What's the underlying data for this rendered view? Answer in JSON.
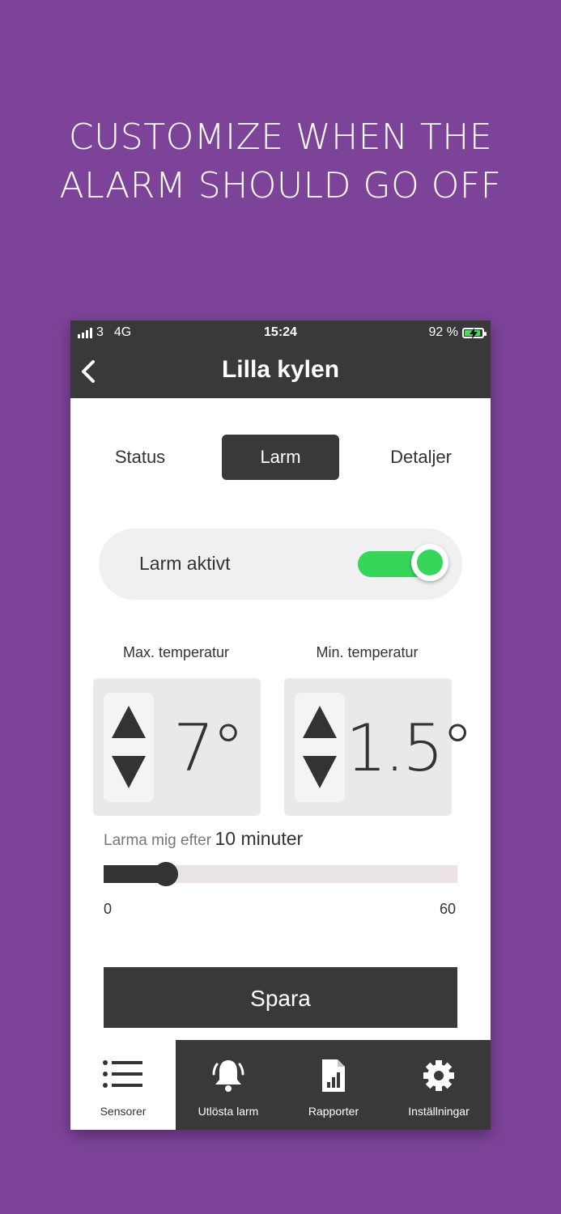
{
  "headline": {
    "line1": "CUSTOMIZE WHEN THE",
    "line2": "ALARM SHOULD GO OFF"
  },
  "status_bar": {
    "carrier": "3",
    "network": "4G",
    "time": "15:24",
    "battery": "92 %"
  },
  "nav": {
    "title": "Lilla kylen"
  },
  "tabs": [
    {
      "label": "Status"
    },
    {
      "label": "Larm"
    },
    {
      "label": "Detaljer"
    }
  ],
  "alarm_toggle": {
    "label": "Larm aktivt",
    "on": true
  },
  "max_temp": {
    "label": "Max. temperatur",
    "value": "7°"
  },
  "min_temp": {
    "label": "Min. temperatur",
    "value": "1.5°"
  },
  "delay": {
    "prefix": "Larma mig efter",
    "value": "10 minuter",
    "minutes": 10,
    "min": "0",
    "max": "60"
  },
  "save_label": "Spara",
  "bottom_tabs": [
    {
      "label": "Sensorer",
      "icon": "list-icon"
    },
    {
      "label": "Utlösta larm",
      "icon": "bell-icon"
    },
    {
      "label": "Rapporter",
      "icon": "report-icon"
    },
    {
      "label": "Inställningar",
      "icon": "gear-icon"
    }
  ],
  "colors": {
    "background": "#7d4399",
    "dark": "#393939",
    "accent_green": "#36d65a"
  }
}
